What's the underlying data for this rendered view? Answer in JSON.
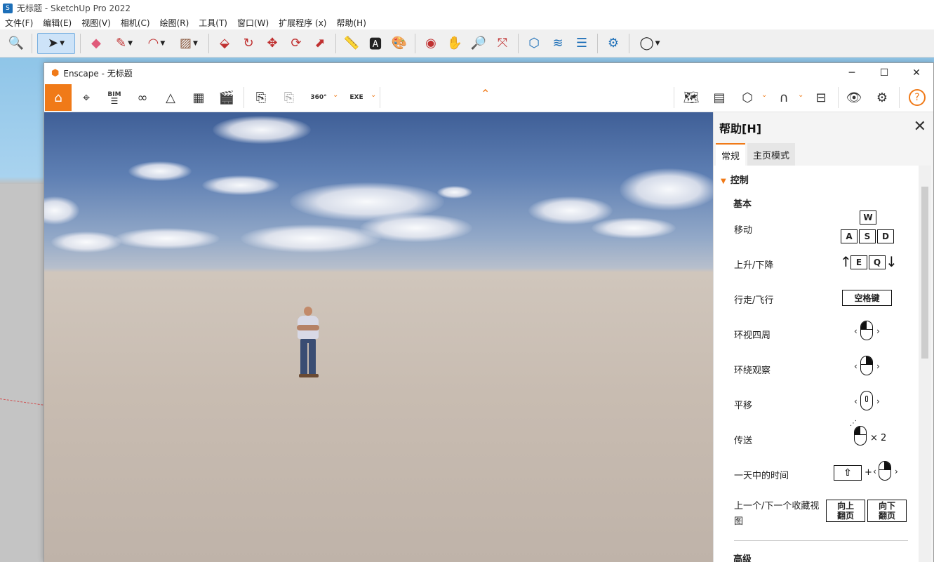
{
  "sketchup": {
    "title": "无标题 - SketchUp Pro 2022",
    "menu": [
      "文件(F)",
      "编辑(E)",
      "视图(V)",
      "相机(C)",
      "绘图(R)",
      "工具(T)",
      "窗口(W)",
      "扩展程序 (x)",
      "帮助(H)"
    ]
  },
  "enscape": {
    "title": "Enscape - 无标题",
    "window_controls": {
      "minimize": "─",
      "maximize": "☐",
      "close": "✕"
    },
    "toolbar": {
      "bim_label": "BIM",
      "pano_label": "360°",
      "exe_label": "EXE",
      "help_label": "?"
    }
  },
  "help": {
    "title": "帮助[H]",
    "tabs": [
      "常规",
      "主页模式"
    ],
    "section": "控制",
    "subsection": "基本",
    "rows": {
      "move": "移动",
      "updown": "上升/下降",
      "walkfly": "行走/飞行",
      "lookaround": "环视四周",
      "orbit": "环绕观察",
      "pan": "平移",
      "teleport": "传送",
      "timeofday": "一天中的时间",
      "views": "上一个/下一个收藏视图"
    },
    "keys": {
      "w": "W",
      "a": "A",
      "s": "S",
      "d": "D",
      "e": "E",
      "q": "Q",
      "space": "空格键",
      "times2": "× 2",
      "plus": "+",
      "pageup_1": "向上",
      "pageup_2": "翻页",
      "pagedown_1": "向下",
      "pagedown_2": "翻页"
    },
    "advanced": "高级"
  }
}
